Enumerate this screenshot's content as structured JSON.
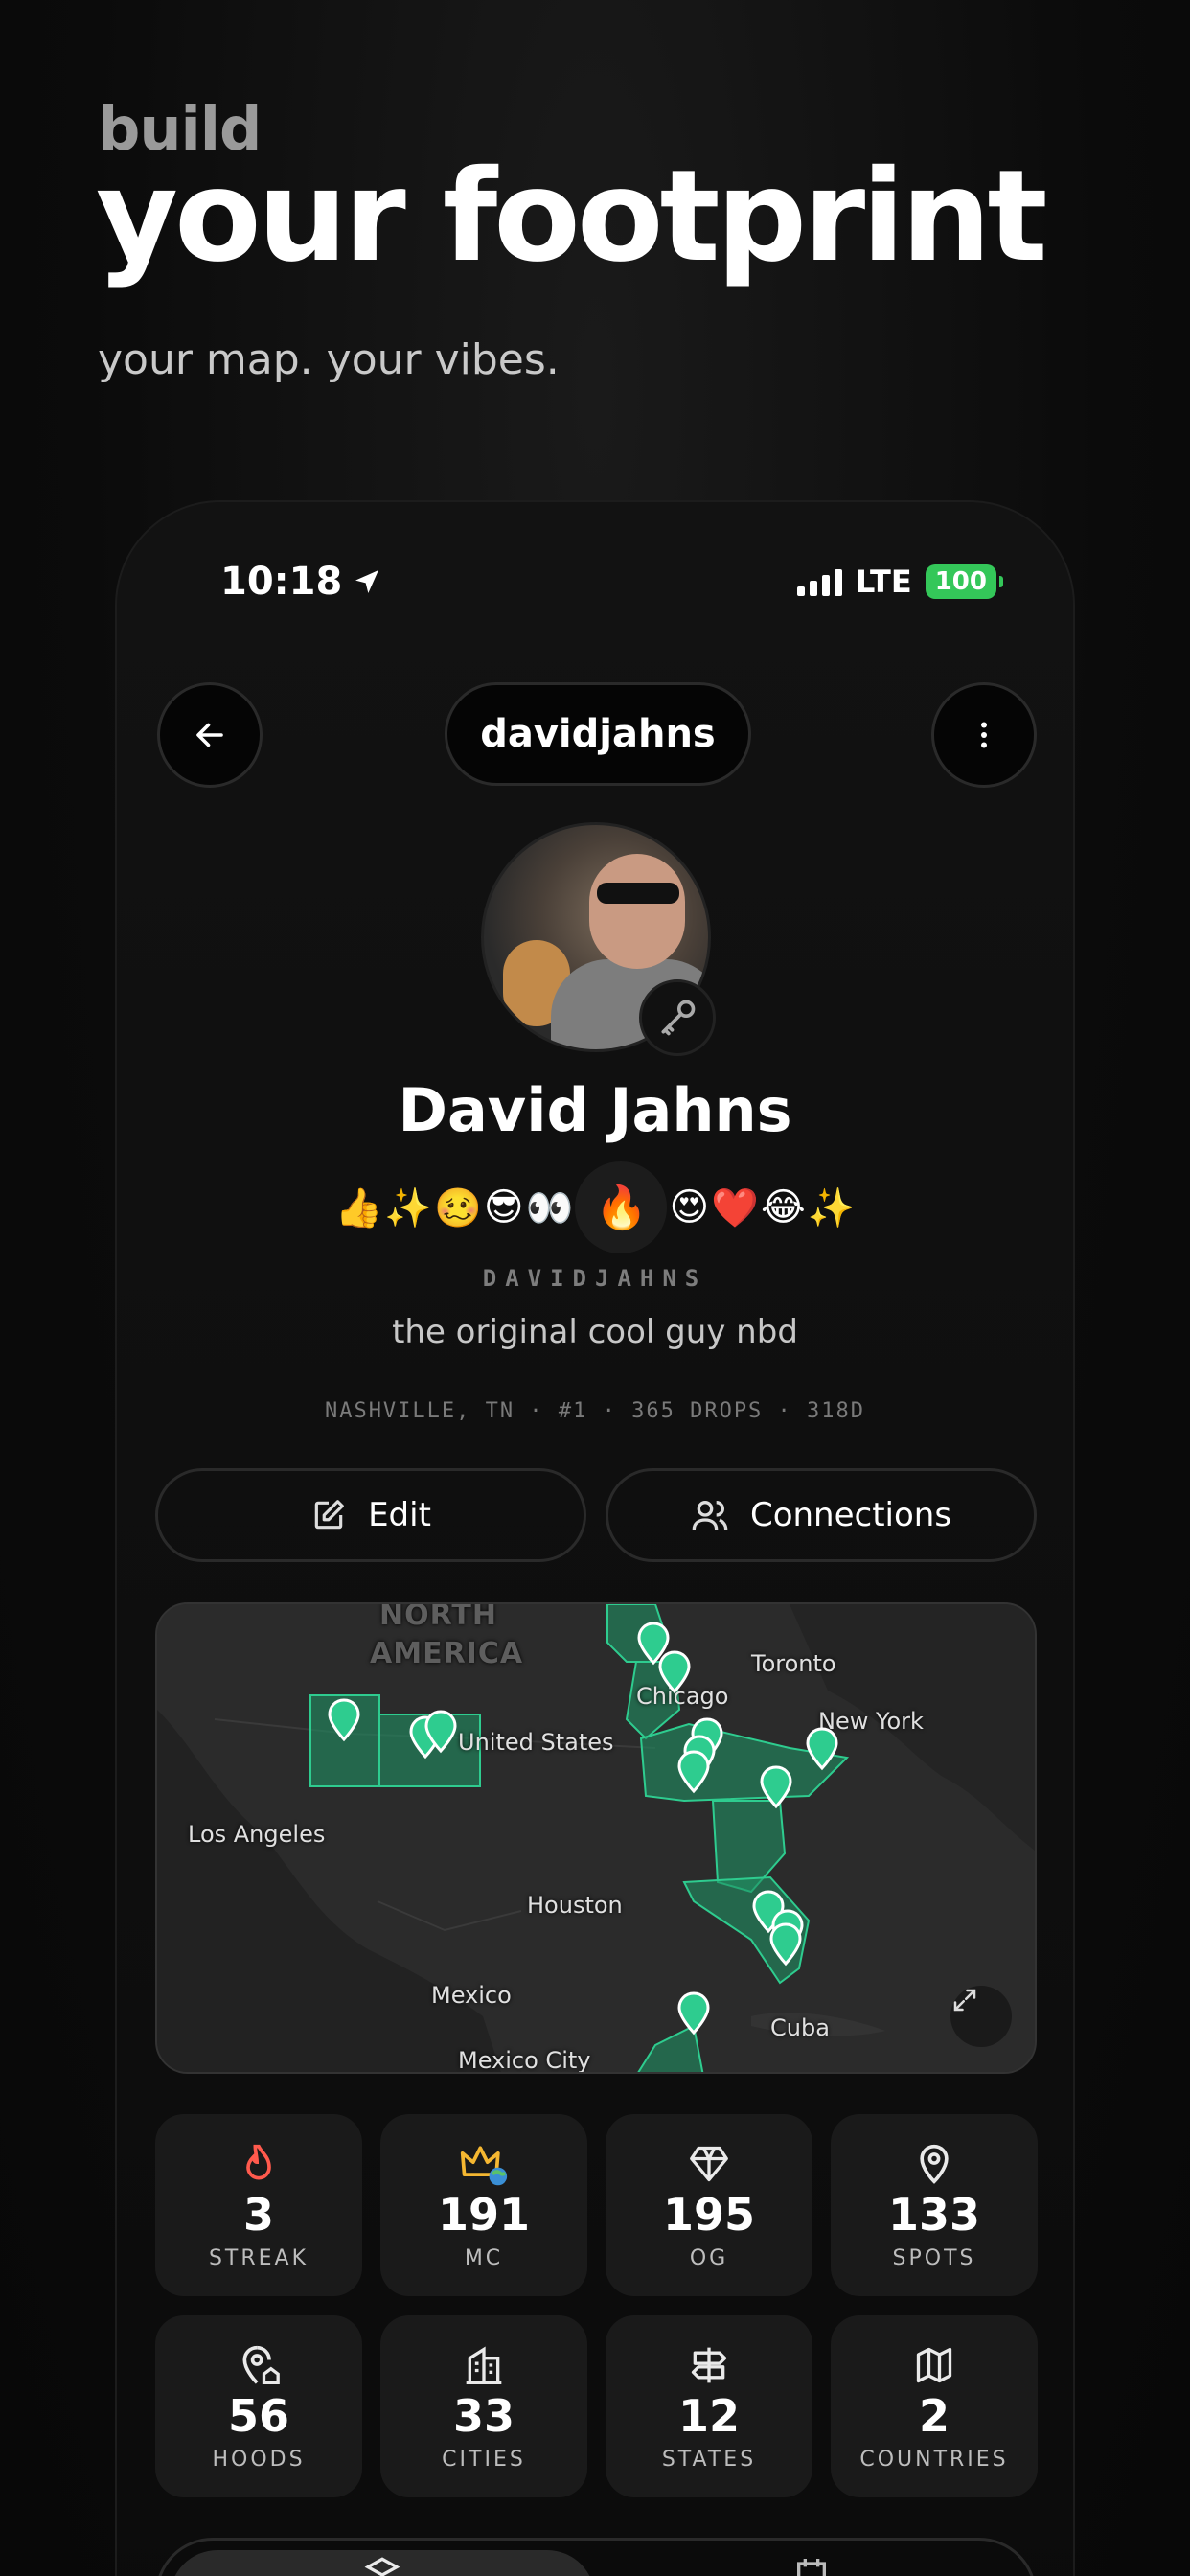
{
  "hero": {
    "kicker": "build",
    "title": "your footprint",
    "subtitle": "your map. your vibes."
  },
  "status_bar": {
    "time": "10:18",
    "network": "LTE",
    "battery": "100"
  },
  "header": {
    "back_icon": "arrow-left-icon",
    "username": "davidjahns",
    "more_icon": "more-vertical-icon"
  },
  "profile": {
    "name": "David Jahns",
    "emojis": [
      "👍",
      "✨",
      "🥴",
      "😎",
      "👀",
      "🔥",
      "😍",
      "❤️",
      "😂",
      "✨"
    ],
    "handle": "DAVIDJAHNS",
    "bio": "the original cool guy nbd",
    "meta": "NASHVILLE, TN · #1 · 365 DROPS · 318D"
  },
  "actions": {
    "edit_label": "Edit",
    "connections_label": "Connections"
  },
  "map": {
    "labels": [
      "NORTH",
      "AMERICA",
      "Toronto",
      "Chicago",
      "New York",
      "United States",
      "Los Angeles",
      "Houston",
      "Mexico",
      "Cuba",
      "Mexico City"
    ],
    "highlight_color": "#1f8f63",
    "pin_color": "#2ecc8f"
  },
  "stats": [
    {
      "icon": "flame-icon",
      "value": "3",
      "label": "STREAK",
      "color": "#ff5a4d"
    },
    {
      "icon": "crown-globe-icon",
      "value": "191",
      "label": "MC",
      "color": "#f5b731"
    },
    {
      "icon": "diamond-icon",
      "value": "195",
      "label": "OG",
      "color": "#eaeaea"
    },
    {
      "icon": "map-pin-icon",
      "value": "133",
      "label": "SPOTS",
      "color": "#eaeaea"
    },
    {
      "icon": "neighborhood-pin-icon",
      "value": "56",
      "label": "HOODS",
      "color": "#eaeaea"
    },
    {
      "icon": "building-icon",
      "value": "33",
      "label": "CITIES",
      "color": "#eaeaea"
    },
    {
      "icon": "signpost-icon",
      "value": "12",
      "label": "STATES",
      "color": "#eaeaea"
    },
    {
      "icon": "map-icon",
      "value": "2",
      "label": "COUNTRIES",
      "color": "#eaeaea"
    }
  ]
}
